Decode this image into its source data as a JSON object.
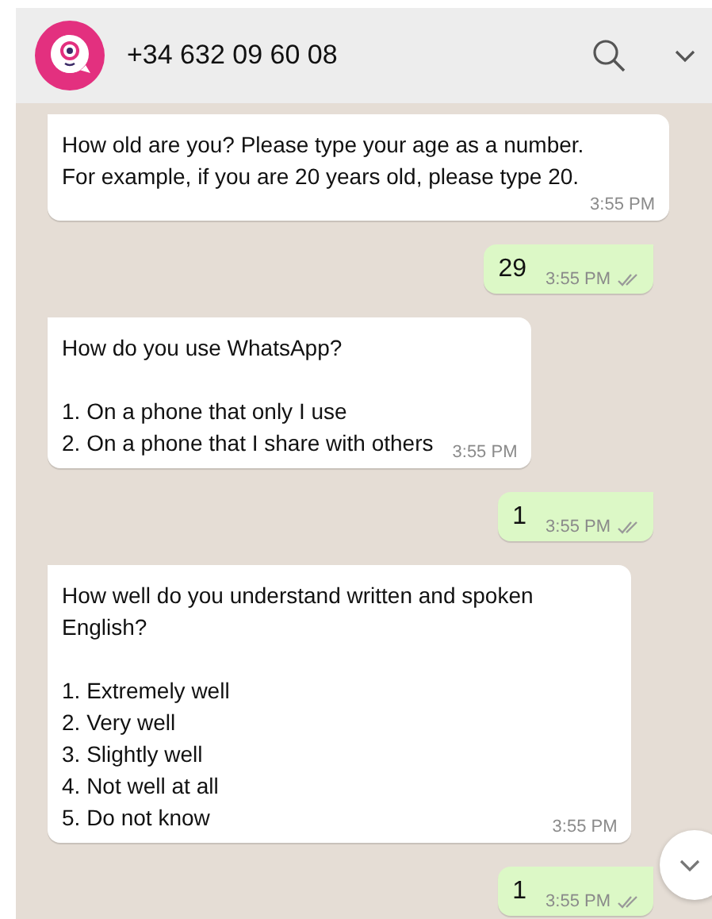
{
  "header": {
    "contact": "+34 632 09 60 08"
  },
  "messages": [
    {
      "kind": "incoming",
      "text": "How old are you? Please type your age as a number.\nFor example, if you are 20 years old, please type 20.",
      "time": "3:55 PM"
    },
    {
      "kind": "outgoing",
      "text": "29",
      "time": "3:55 PM",
      "read": false
    },
    {
      "kind": "incoming",
      "text": "How do you use WhatsApp?\n\n1. On a phone that only I use\n2. On a phone that I share with others",
      "time": "3:55 PM"
    },
    {
      "kind": "outgoing",
      "text": "1",
      "time": "3:55 PM",
      "read": false
    },
    {
      "kind": "incoming",
      "text": "How well do you understand written and spoken\nEnglish?\n\n1. Extremely well\n2. Very well\n3. Slightly well\n4. Not well at all\n5. Do not know",
      "time": "3:55 PM"
    },
    {
      "kind": "outgoing",
      "text": "1",
      "time": "3:55 PM",
      "read": false
    }
  ]
}
